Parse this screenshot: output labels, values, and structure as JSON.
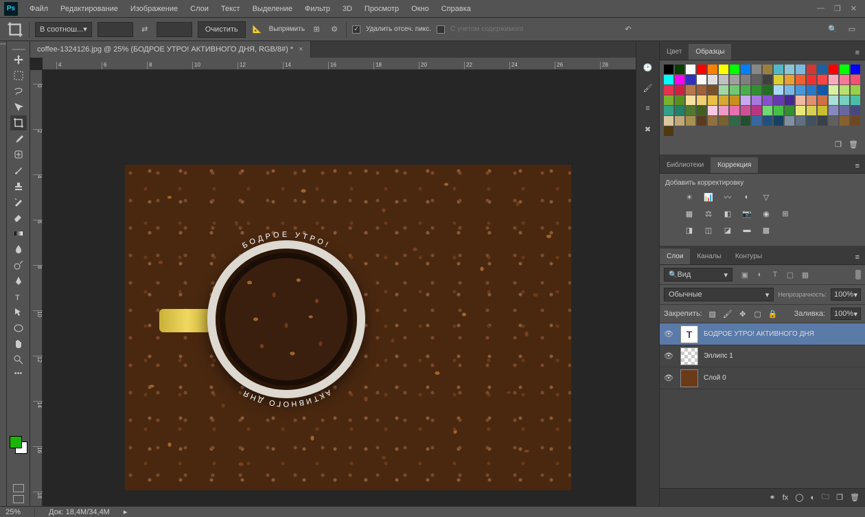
{
  "menubar": {
    "items": [
      "Файл",
      "Редактирование",
      "Изображение",
      "Слои",
      "Текст",
      "Выделение",
      "Фильтр",
      "3D",
      "Просмотр",
      "Окно",
      "Справка"
    ]
  },
  "optionsbar": {
    "ratio_label": "В соотнош...",
    "clear": "Очистить",
    "straighten": "Выпрямить",
    "delete_cropped": "Удалить отсеч. пикс.",
    "content_aware": "С учетом содержимого"
  },
  "document": {
    "tab_title": "coffee-1324126.jpg @ 25% (БОДРОЕ УТРО!   АКТИВНОГО ДНЯ, RGB/8#) *"
  },
  "canvas": {
    "text_top": "БОДРОЕ УТРО!",
    "text_bottom": "АКТИВНОГО ДНЯ"
  },
  "panels": {
    "color_tab": "Цвет",
    "swatches_tab": "Образцы",
    "libraries_tab": "Библиотеки",
    "adjustments_tab": "Коррекция",
    "adjust_label": "Добавить корректировку",
    "layers_tab": "Слои",
    "channels_tab": "Каналы",
    "paths_tab": "Контуры"
  },
  "layers": {
    "filter_kind": "Вид",
    "blend_mode": "Обычные",
    "opacity_label": "Непрозрачность:",
    "opacity_val": "100%",
    "lock_label": "Закрепить:",
    "fill_label": "Заливка:",
    "fill_val": "100%",
    "items": [
      {
        "name": "БОДРОЕ УТРО!   АКТИВНОГО ДНЯ",
        "type": "text",
        "selected": true
      },
      {
        "name": "Эллипс 1",
        "type": "shape",
        "selected": false
      },
      {
        "name": "Слой 0",
        "type": "image",
        "selected": false
      }
    ]
  },
  "statusbar": {
    "zoom": "25%",
    "doc_size": "Док: 18,4M/34,4M"
  },
  "ruler_h": [
    "4",
    "6",
    "8",
    "10",
    "12",
    "14",
    "16",
    "18",
    "20",
    "22",
    "24",
    "26",
    "28"
  ],
  "ruler_v": [
    "0",
    "2",
    "4",
    "6",
    "8",
    "10",
    "12",
    "14",
    "16",
    "18"
  ],
  "swatches": [
    [
      "#000",
      "#0a3d00",
      "#fff",
      "#ff0000",
      "#ff8000",
      "#ffff00",
      "#00ff00",
      "#0080ff",
      "#888",
      "#9a8040",
      "#52b8c8",
      "#8ac7d4",
      "#7ab8e0",
      "#d03838",
      "#2060a0"
    ],
    [
      "#ff0000",
      "#00ff00",
      "#0000ff",
      "#00ffff",
      "#ff00ff",
      "#3030c0",
      "#ffffff",
      "#e0e0e0",
      "#c0c0c0",
      "#a0a0a0",
      "#808080",
      "#606060",
      "#404040",
      "#d8d030",
      "#e8a030",
      "#f06030",
      "#f03030",
      "#ff4444"
    ],
    [
      "#f8a8c0",
      "#f87898",
      "#f85070",
      "#e83050",
      "#d02040",
      "#b87848",
      "#a06038",
      "#785028",
      "#a0d8a0",
      "#70c870",
      "#48b048",
      "#309030",
      "#207020",
      "#a8d8f8",
      "#78b8e8",
      "#4898d8",
      "#2878c8",
      "#1058a8"
    ],
    [
      "#d8f0a0",
      "#b8e070",
      "#98d048",
      "#78b030",
      "#589020",
      "#f8e0a0",
      "#f0d070",
      "#e8c048",
      "#d8a830",
      "#c89020",
      "#c8a8f0",
      "#a878e0",
      "#8850d0",
      "#6838b0",
      "#482890",
      "#f0b8a0",
      "#e09070",
      "#d07048"
    ],
    [
      "#a8e0d8",
      "#78d0c0",
      "#48c0a8",
      "#30a088",
      "#208068",
      "#507830",
      "#406020",
      "#f8c8e0",
      "#f098c8",
      "#e870b0",
      "#d05098",
      "#b83880",
      "#70d870",
      "#48c048",
      "#309030",
      "#e8e878",
      "#d8d050",
      "#c8c030"
    ],
    [
      "#8888c0",
      "#6868a0",
      "#484880",
      "#d8c8a0",
      "#c0a878",
      "#a89050",
      "#5a3a20",
      "#907040",
      "#786030",
      "#306848",
      "#205030",
      "#3868a0",
      "#205080",
      "#184060",
      "#8090a0",
      "#607080",
      "#405060",
      "#384048"
    ],
    [
      "#606060",
      "#886030",
      "#704820",
      "#503810"
    ]
  ]
}
